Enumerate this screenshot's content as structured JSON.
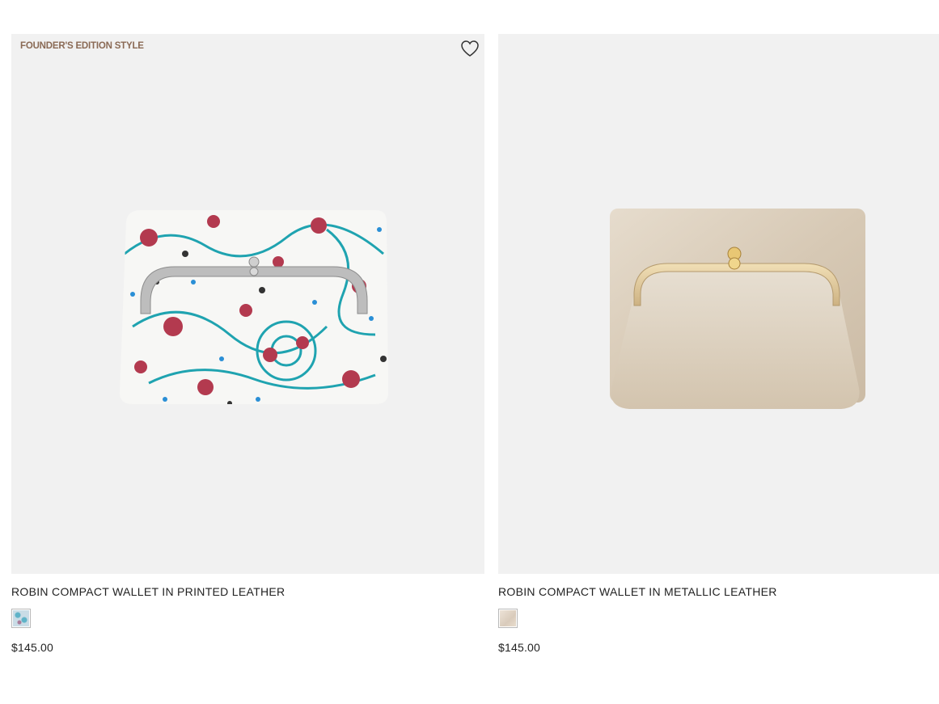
{
  "products": [
    {
      "badge": "FOUNDER'S EDITION STYLE",
      "title": "ROBIN COMPACT WALLET IN PRINTED LEATHER",
      "price": "$145.00",
      "wishlist_icon": "heart-outline-icon",
      "swatch": "printed-floral"
    },
    {
      "title": "ROBIN COMPACT WALLET IN METALLIC LEATHER",
      "price": "$145.00",
      "swatch": "metallic-gold"
    }
  ],
  "colors": {
    "badge": "#8a6a55",
    "image_background": "#f1f1f1",
    "text": "#222222"
  }
}
